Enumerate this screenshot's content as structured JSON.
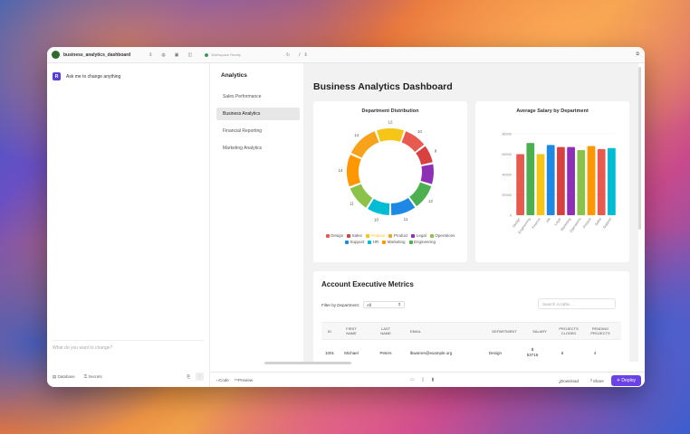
{
  "topbar": {
    "project_name": "business_analytics_dashboard",
    "url_status": "Workspace Ready",
    "path_text": "/"
  },
  "chat": {
    "avatar_letter": "R",
    "prompt_label": "Ask me to change anything",
    "input_placeholder": "What do you want to change?",
    "footer_database": "Database",
    "footer_secrets": "Secrets"
  },
  "sidebar": {
    "title": "Analytics",
    "items": [
      {
        "label": "Sales Performance",
        "active": false
      },
      {
        "label": "Business Analytics",
        "active": true
      },
      {
        "label": "Financial Reporting",
        "active": false
      },
      {
        "label": "Marketing Analytics",
        "active": false
      }
    ]
  },
  "dashboard": {
    "title": "Business Analytics Dashboard"
  },
  "colors": {
    "Design": "#e85a4f",
    "Sales": "#d94141",
    "Finance": "#f5c518",
    "Product": "#f7a21b",
    "Legal": "#8e2fb5",
    "Operations": "#8bc34a",
    "Support": "#1e88e5",
    "HR": "#00bcd4",
    "Marketing": "#ff9800",
    "Engineering": "#4caf50",
    "accent": "#6b42e6"
  },
  "chart_data": [
    {
      "type": "pie",
      "title": "Department Distribution",
      "categories": [
        "Finance",
        "Design",
        "Sales",
        "Legal",
        "Engineering",
        "Support",
        "HR",
        "Operations",
        "Marketing",
        "Product"
      ],
      "values": [
        12,
        10,
        8,
        9,
        11,
        11,
        10,
        11,
        14,
        14
      ],
      "label_values": [
        "12",
        "10",
        "8",
        "",
        "12",
        "11",
        "10",
        "11",
        "14",
        "14"
      ],
      "legend": [
        "Design",
        "Sales",
        "Finance",
        "Product",
        "Legal",
        "Operations",
        "Support",
        "HR",
        "Marketing",
        "Engineering"
      ],
      "legend_position": "bottom"
    },
    {
      "type": "bar",
      "title": "Average Salary by Department",
      "categories": [
        "Design",
        "Engineering",
        "Finance",
        "HR",
        "Legal",
        "Marketing",
        "Operations",
        "Product",
        "Sales",
        "Support"
      ],
      "values": [
        60000,
        71000,
        60000,
        69000,
        67000,
        67000,
        64000,
        68000,
        65000,
        66000
      ],
      "ylim": [
        0,
        80000
      ],
      "yticks": [
        "80000",
        "60000",
        "40000",
        "20000",
        "0"
      ],
      "bar_colors": [
        "#e85a4f",
        "#4caf50",
        "#f5c518",
        "#1e88e5",
        "#d94141",
        "#8e2fb5",
        "#8bc34a",
        "#ff9800",
        "#e85a4f",
        "#00bcd4"
      ]
    }
  ],
  "metrics": {
    "title": "Account Executive Metrics",
    "filter_label": "Filter by Department:",
    "filter_value": "All",
    "search_placeholder": "Search in table...",
    "columns": [
      "ID",
      "FIRST NAME",
      "LAST NAME",
      "EMAIL",
      "DEPARTMENT",
      "SALARY",
      "PROJECTS CLOSED",
      "PENDING PROJECTS"
    ],
    "rows": [
      [
        "1001",
        "Michael",
        "Peters",
        "lbwarren@example.org",
        "Design",
        "$ 53716",
        "6",
        "4"
      ]
    ]
  },
  "bottombar": {
    "code_label": "Code",
    "preview_label": "Preview",
    "download_label": "Download",
    "share_label": "Share",
    "deploy_label": "Deploy"
  }
}
